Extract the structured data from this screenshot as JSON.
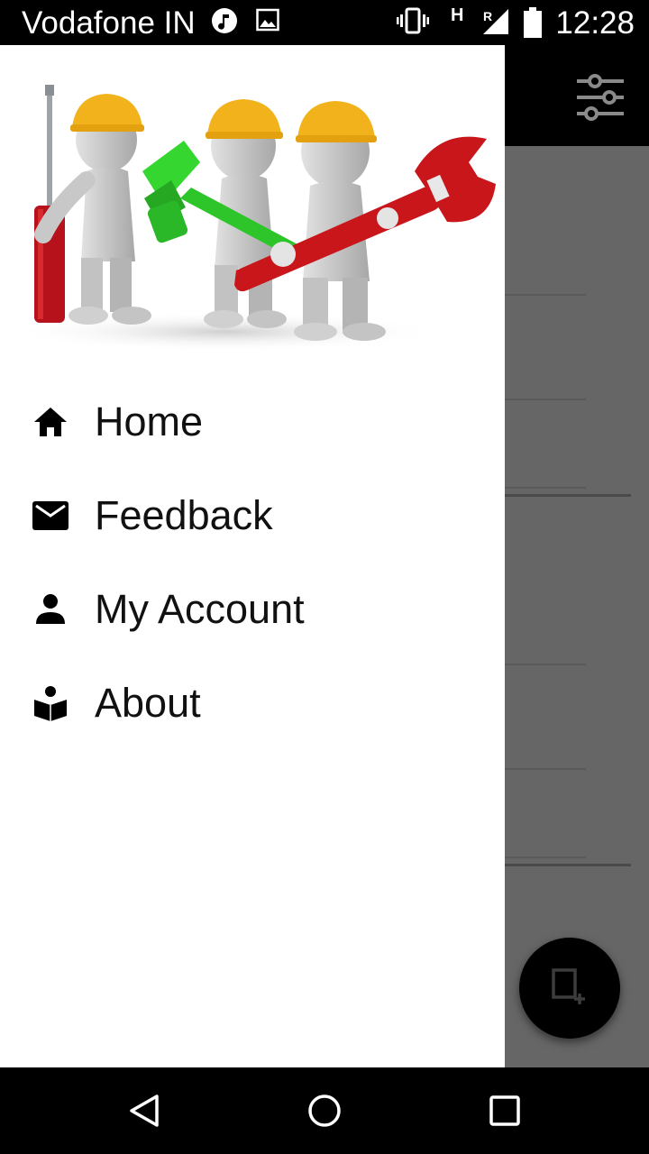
{
  "status_bar": {
    "carrier": "Vodafone IN",
    "time": "12:28",
    "network_type": "H",
    "roaming": "R",
    "icons": [
      "music-icon",
      "image-icon",
      "vibrate-icon",
      "signal-icon",
      "battery-icon"
    ]
  },
  "app": {
    "toolbar_icon": "filter-sliders-icon",
    "fab_icon": "add-note-icon"
  },
  "drawer": {
    "header_image": "workers-with-tools-illustration",
    "items": [
      {
        "label": "Home",
        "icon": "home-icon"
      },
      {
        "label": "Feedback",
        "icon": "mail-icon"
      },
      {
        "label": "My Account",
        "icon": "person-icon"
      },
      {
        "label": "About",
        "icon": "reader-icon"
      }
    ]
  },
  "nav_bar": {
    "buttons": [
      "back-icon",
      "home-circle-icon",
      "recents-icon"
    ]
  },
  "colors": {
    "helmet": "#f2b21c",
    "hammer": "#2ec52a",
    "wrench": "#c8161b",
    "screwdriver_handle": "#b5121b",
    "scrim": "#666666"
  }
}
